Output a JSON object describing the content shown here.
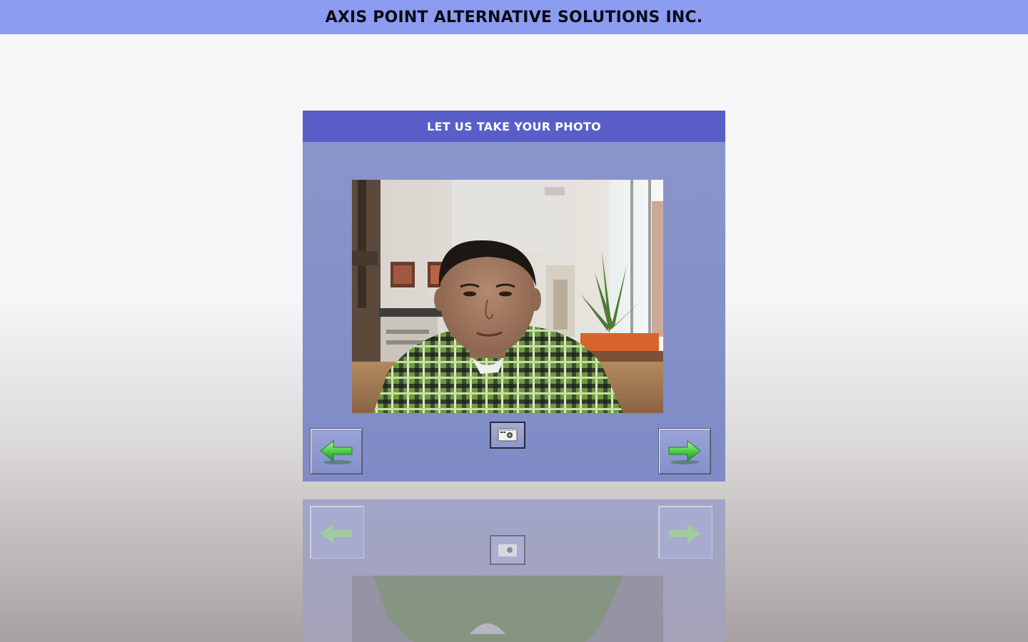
{
  "header": {
    "company_name": "AXIS POINT ALTERNATIVE SOLUTIONS INC."
  },
  "panel": {
    "title": "LET US TAKE YOUR PHOTO"
  },
  "controls": {
    "back_icon": "left-arrow-icon",
    "next_icon": "right-arrow-icon",
    "capture_icon": "camera-icon"
  },
  "colors": {
    "header_bar": "#8b9cf1",
    "panel_header": "#5a5ec8",
    "panel_body": "#8b96cb",
    "arrow_green": "#3fbf3f"
  }
}
